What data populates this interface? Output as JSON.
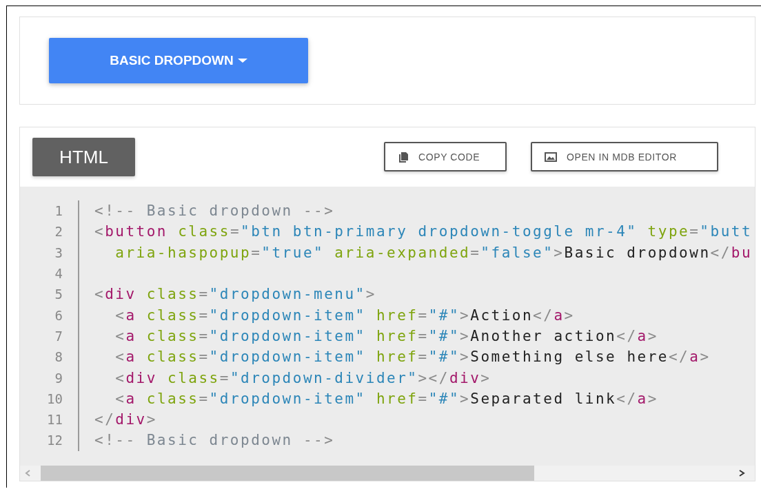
{
  "preview": {
    "dropdown_button": {
      "label": "BASIC DROPDOWN"
    }
  },
  "code_panel": {
    "tab": {
      "label": "HTML",
      "selected": true
    },
    "actions": [
      {
        "kind": "copy",
        "label": "COPY CODE"
      },
      {
        "kind": "editor",
        "label": "OPEN IN MDB EDITOR"
      }
    ],
    "lines": [
      {
        "number": "1",
        "tokens": [
          {
            "kind": "punct",
            "text": "<!--"
          },
          {
            "kind": "comment",
            "text": " Basic dropdown "
          },
          {
            "kind": "punct",
            "text": "-->"
          }
        ]
      },
      {
        "number": "2",
        "tokens": [
          {
            "kind": "punct",
            "text": "<"
          },
          {
            "kind": "tag",
            "text": "button"
          },
          {
            "kind": "attr",
            "text": " class"
          },
          {
            "kind": "punct",
            "text": "="
          },
          {
            "kind": "string",
            "text": "\"btn btn-primary dropdown-toggle mr-4\""
          },
          {
            "kind": "attr",
            "text": " type"
          },
          {
            "kind": "punct",
            "text": "="
          },
          {
            "kind": "string",
            "text": "\"butt"
          }
        ]
      },
      {
        "number": "3",
        "tokens": [
          {
            "kind": "attr",
            "text": "  aria-haspopup"
          },
          {
            "kind": "punct",
            "text": "="
          },
          {
            "kind": "string",
            "text": "\"true\""
          },
          {
            "kind": "attr",
            "text": " aria-expanded"
          },
          {
            "kind": "punct",
            "text": "="
          },
          {
            "kind": "string",
            "text": "\"false\""
          },
          {
            "kind": "punct",
            "text": ">"
          },
          {
            "kind": "text",
            "text": "Basic dropdown"
          },
          {
            "kind": "punct",
            "text": "</"
          },
          {
            "kind": "tag",
            "text": "bu"
          }
        ]
      },
      {
        "number": "4"
      },
      {
        "number": "5",
        "tokens": [
          {
            "kind": "punct",
            "text": "<"
          },
          {
            "kind": "tag",
            "text": "div"
          },
          {
            "kind": "attr",
            "text": " class"
          },
          {
            "kind": "punct",
            "text": "="
          },
          {
            "kind": "string",
            "text": "\"dropdown-menu\""
          },
          {
            "kind": "punct",
            "text": ">"
          }
        ]
      },
      {
        "number": "6",
        "tokens": [
          {
            "kind": "punct",
            "text": "  <"
          },
          {
            "kind": "tag",
            "text": "a"
          },
          {
            "kind": "attr",
            "text": " class"
          },
          {
            "kind": "punct",
            "text": "="
          },
          {
            "kind": "string",
            "text": "\"dropdown-item\""
          },
          {
            "kind": "attr",
            "text": " href"
          },
          {
            "kind": "punct",
            "text": "="
          },
          {
            "kind": "string",
            "text": "\"#\""
          },
          {
            "kind": "punct",
            "text": ">"
          },
          {
            "kind": "text",
            "text": "Action"
          },
          {
            "kind": "punct",
            "text": "</"
          },
          {
            "kind": "tag",
            "text": "a"
          },
          {
            "kind": "punct",
            "text": ">"
          }
        ]
      },
      {
        "number": "7",
        "tokens": [
          {
            "kind": "punct",
            "text": "  <"
          },
          {
            "kind": "tag",
            "text": "a"
          },
          {
            "kind": "attr",
            "text": " class"
          },
          {
            "kind": "punct",
            "text": "="
          },
          {
            "kind": "string",
            "text": "\"dropdown-item\""
          },
          {
            "kind": "attr",
            "text": " href"
          },
          {
            "kind": "punct",
            "text": "="
          },
          {
            "kind": "string",
            "text": "\"#\""
          },
          {
            "kind": "punct",
            "text": ">"
          },
          {
            "kind": "text",
            "text": "Another action"
          },
          {
            "kind": "punct",
            "text": "</"
          },
          {
            "kind": "tag",
            "text": "a"
          },
          {
            "kind": "punct",
            "text": ">"
          }
        ]
      },
      {
        "number": "8",
        "tokens": [
          {
            "kind": "punct",
            "text": "  <"
          },
          {
            "kind": "tag",
            "text": "a"
          },
          {
            "kind": "attr",
            "text": " class"
          },
          {
            "kind": "punct",
            "text": "="
          },
          {
            "kind": "string",
            "text": "\"dropdown-item\""
          },
          {
            "kind": "attr",
            "text": " href"
          },
          {
            "kind": "punct",
            "text": "="
          },
          {
            "kind": "string",
            "text": "\"#\""
          },
          {
            "kind": "punct",
            "text": ">"
          },
          {
            "kind": "text",
            "text": "Something else here"
          },
          {
            "kind": "punct",
            "text": "</"
          },
          {
            "kind": "tag",
            "text": "a"
          },
          {
            "kind": "punct",
            "text": ">"
          }
        ]
      },
      {
        "number": "9",
        "tokens": [
          {
            "kind": "punct",
            "text": "  <"
          },
          {
            "kind": "tag",
            "text": "div"
          },
          {
            "kind": "attr",
            "text": " class"
          },
          {
            "kind": "punct",
            "text": "="
          },
          {
            "kind": "string",
            "text": "\"dropdown-divider\""
          },
          {
            "kind": "punct",
            "text": "></"
          },
          {
            "kind": "tag",
            "text": "div"
          },
          {
            "kind": "punct",
            "text": ">"
          }
        ]
      },
      {
        "number": "10",
        "tokens": [
          {
            "kind": "punct",
            "text": "  <"
          },
          {
            "kind": "tag",
            "text": "a"
          },
          {
            "kind": "attr",
            "text": " class"
          },
          {
            "kind": "punct",
            "text": "="
          },
          {
            "kind": "string",
            "text": "\"dropdown-item\""
          },
          {
            "kind": "attr",
            "text": " href"
          },
          {
            "kind": "punct",
            "text": "="
          },
          {
            "kind": "string",
            "text": "\"#\""
          },
          {
            "kind": "punct",
            "text": ">"
          },
          {
            "kind": "text",
            "text": "Separated link"
          },
          {
            "kind": "punct",
            "text": "</"
          },
          {
            "kind": "tag",
            "text": "a"
          },
          {
            "kind": "punct",
            "text": ">"
          }
        ]
      },
      {
        "number": "11",
        "tokens": [
          {
            "kind": "punct",
            "text": "</"
          },
          {
            "kind": "tag",
            "text": "div"
          },
          {
            "kind": "punct",
            "text": ">"
          }
        ]
      },
      {
        "number": "12",
        "tokens": [
          {
            "kind": "punct",
            "text": "<!--"
          },
          {
            "kind": "comment",
            "text": " Basic dropdown "
          },
          {
            "kind": "punct",
            "text": "-->"
          }
        ]
      }
    ]
  }
}
